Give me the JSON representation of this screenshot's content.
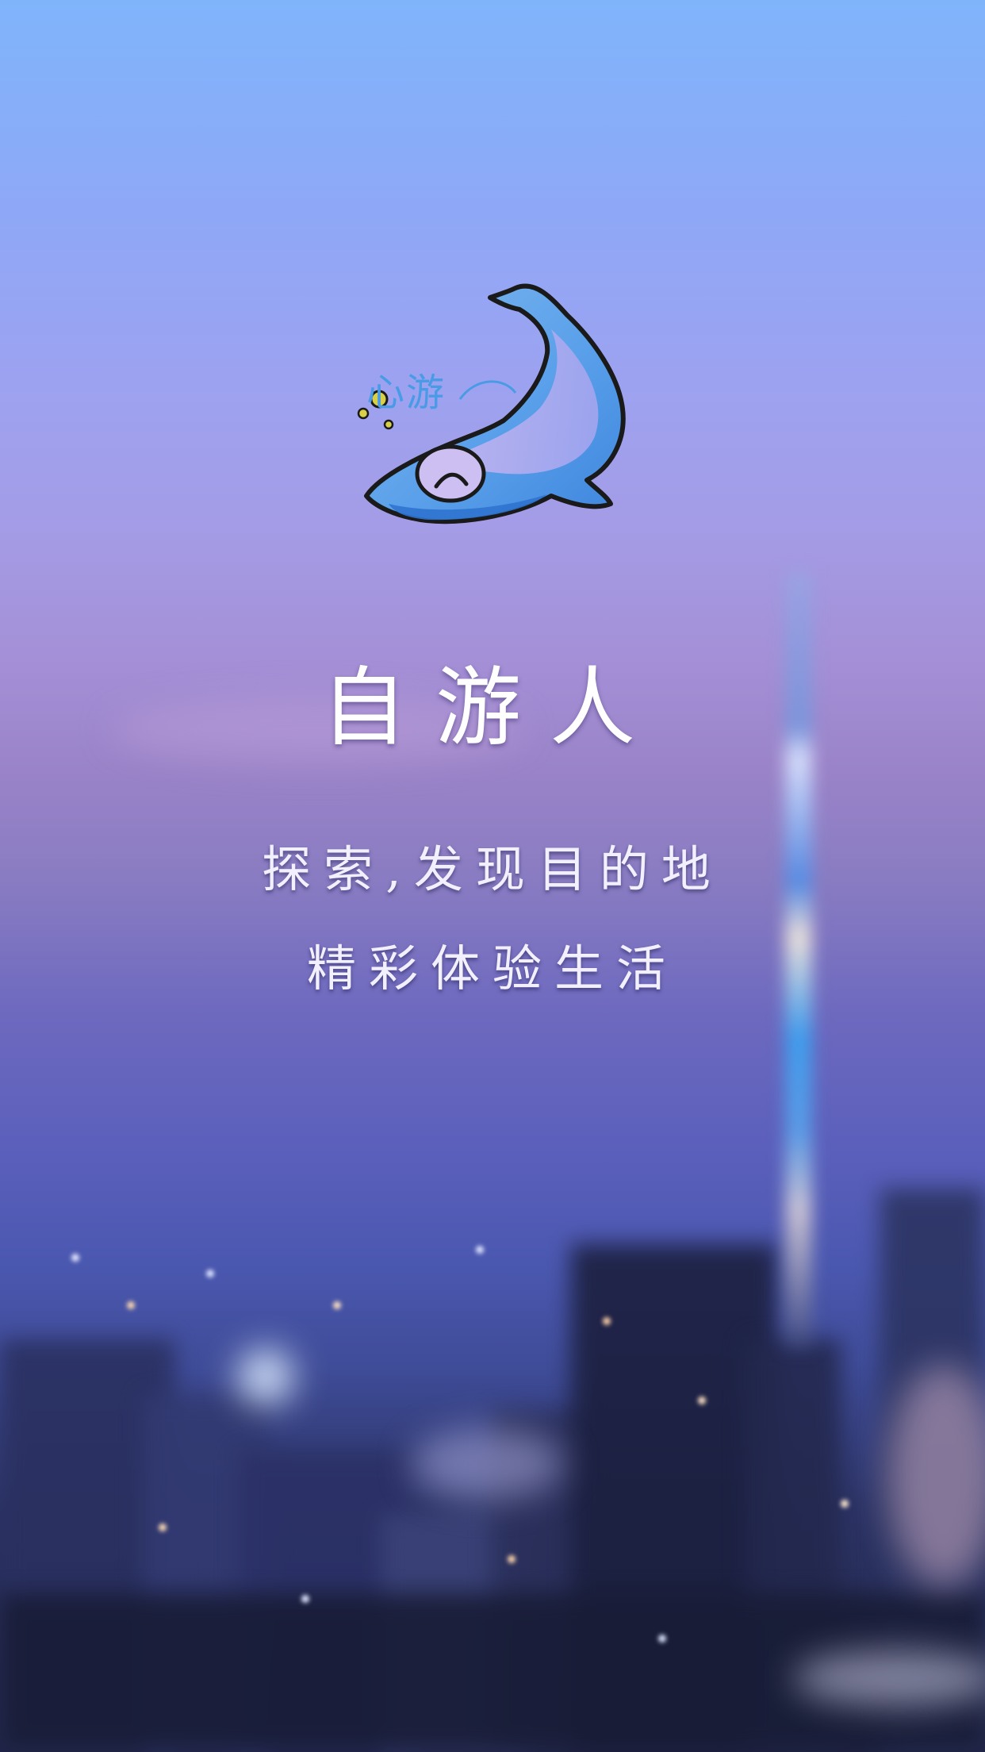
{
  "splash": {
    "logo_text": "心游",
    "app_title": "自游人",
    "tagline_line1": "探索,发现目的地",
    "tagline_line2": "精彩体验生活"
  },
  "icons": {
    "logo": "dolphin-logo-icon"
  },
  "colors": {
    "sky_top": "#7fb4fb",
    "sky_mid": "#a49ce6",
    "city_dark": "#202545",
    "logo_blue": "#4a9be6"
  }
}
